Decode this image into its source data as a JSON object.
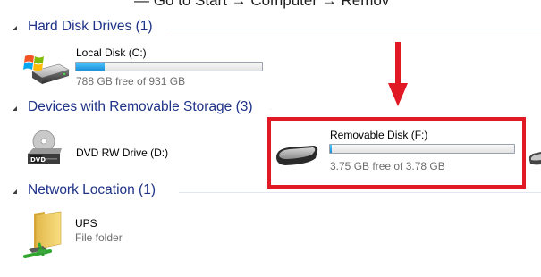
{
  "top_fragment": "— Go to Start → Computer → Remov",
  "groups": {
    "hard_disk": {
      "title": "Hard Disk Drives (1)",
      "items": [
        {
          "name": "Local Disk (C:)",
          "free_text": "788 GB free of 931 GB",
          "used_fraction": 0.154,
          "icon": "windows-drive-icon"
        }
      ]
    },
    "removable": {
      "title": "Devices with Removable Storage (3)",
      "items": [
        {
          "name": "DVD RW Drive (D:)",
          "icon": "dvd-drive-icon"
        },
        {
          "name": "Removable Disk (F:)",
          "free_text": "3.75 GB free of 3.78 GB",
          "used_fraction": 0.008,
          "icon": "usb-drive-icon"
        }
      ]
    },
    "network": {
      "title": "Network Location (1)",
      "items": [
        {
          "name": "UPS",
          "subtitle": "File folder",
          "icon": "network-folder-icon"
        }
      ]
    }
  },
  "colors": {
    "header_text": "#1e3287",
    "bar_fill": "#26a3ec",
    "highlight": "#e11925"
  }
}
